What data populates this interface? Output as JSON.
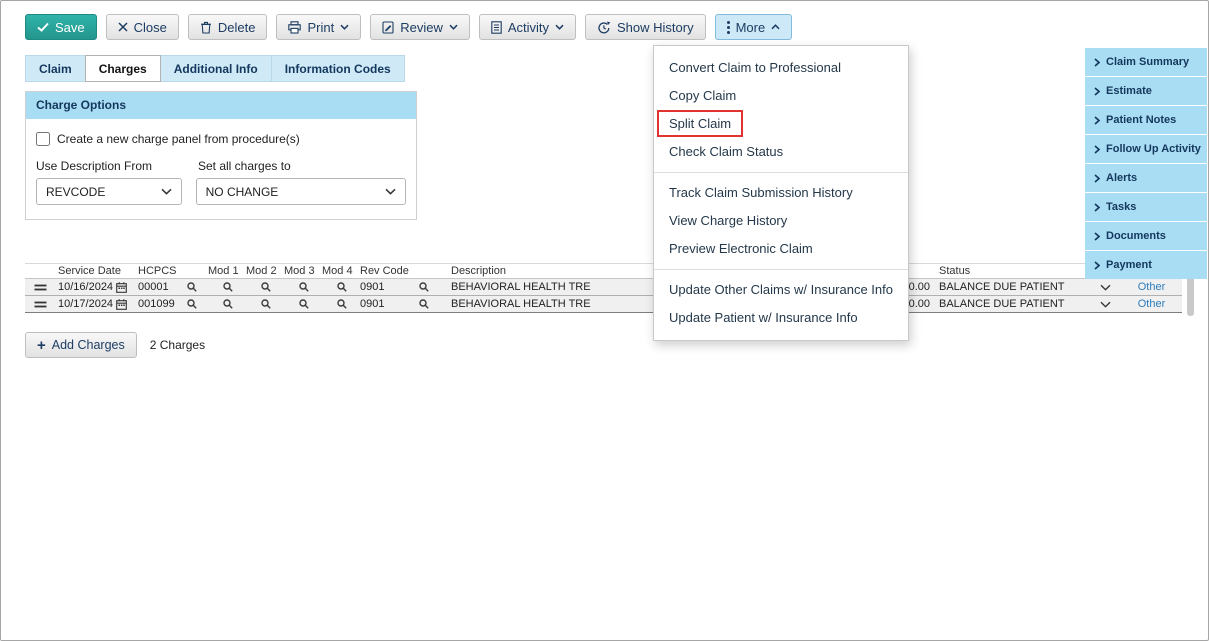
{
  "colors": {
    "accent_blue": "#a9ddf3",
    "save_teal": "#27a59b",
    "link_blue": "#2d7dbd",
    "highlight_red": "#e0322e"
  },
  "toolbar": {
    "save": "Save",
    "close": "Close",
    "delete": "Delete",
    "print": "Print",
    "review": "Review",
    "activity": "Activity",
    "show_history": "Show History",
    "more": "More"
  },
  "tabs": {
    "items": [
      {
        "label": "Claim",
        "active": false
      },
      {
        "label": "Charges",
        "active": true
      },
      {
        "label": "Additional Info",
        "active": false
      },
      {
        "label": "Information Codes",
        "active": false
      }
    ]
  },
  "charge_options": {
    "title": "Charge Options",
    "checkbox_label": "Create a new charge panel from procedure(s)",
    "use_description_label": "Use Description From",
    "use_description_value": "REVCODE",
    "set_all_label": "Set all charges to",
    "set_all_value": "NO CHANGE"
  },
  "more_menu": {
    "groups": [
      [
        "Convert Claim to Professional",
        "Copy Claim",
        "Split Claim",
        "Check Claim Status"
      ],
      [
        "Track Claim Submission History",
        "View Charge History",
        "Preview Electronic Claim"
      ],
      [
        "Update Other Claims w/ Insurance Info",
        "Update Patient w/ Insurance Info"
      ]
    ],
    "highlighted_item": "Split Claim"
  },
  "sidebar": {
    "items": [
      "Claim Summary",
      "Estimate",
      "Patient Notes",
      "Follow Up Activity",
      "Alerts",
      "Tasks",
      "Documents",
      "Payment"
    ]
  },
  "table": {
    "headers": [
      "Service Date",
      "HCPCS",
      "Mod 1",
      "Mod 2",
      "Mod 3",
      "Mod 4",
      "Rev Code",
      "Description",
      "Status"
    ],
    "rows": [
      {
        "service_date": "10/16/2024",
        "hcpcs": "00001",
        "rev_code": "0901",
        "description": "BEHAVIORAL HEALTH TRE",
        "amount": "0.00",
        "status": "BALANCE DUE PATIENT",
        "other_link": "Other"
      },
      {
        "service_date": "10/17/2024",
        "hcpcs": "001099",
        "rev_code": "0901",
        "description": "BEHAVIORAL HEALTH TRE",
        "amount": "0.00",
        "status": "BALANCE DUE PATIENT",
        "other_link": "Other"
      }
    ]
  },
  "footer": {
    "add_charges": "Add Charges",
    "charge_count": "2 Charges"
  }
}
